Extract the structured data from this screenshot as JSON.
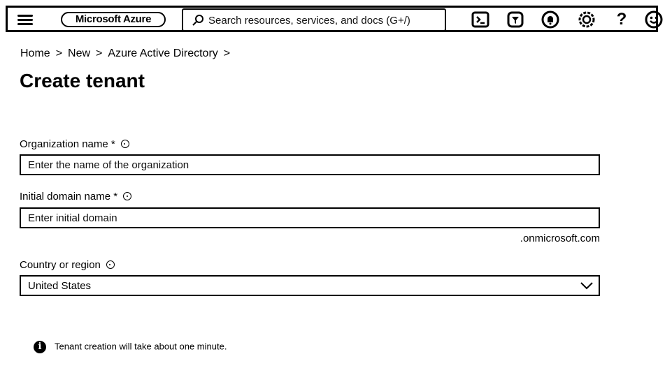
{
  "topbar": {
    "brand": "Microsoft Azure",
    "search_placeholder": "Search resources, services, and docs (G+/)"
  },
  "icons": [
    "menu-icon",
    "cloud-shell-icon",
    "directory-filter-icon",
    "notifications-icon",
    "settings-icon",
    "help-icon",
    "feedback-icon"
  ],
  "breadcrumb": [
    {
      "label": "Home"
    },
    {
      "label": "New"
    },
    {
      "label": "Azure Active Directory"
    }
  ],
  "page": {
    "title": "Create tenant"
  },
  "form": {
    "org_label": "Organization name *",
    "org_placeholder": "Enter the name of the organization",
    "domain_label": "Initial domain name *",
    "domain_placeholder": "Enter initial domain",
    "domain_suffix": ".onmicrosoft.com",
    "country_label": "Country or region",
    "country_value": "United States"
  },
  "notice": {
    "text": "Tenant creation will take about one minute."
  }
}
